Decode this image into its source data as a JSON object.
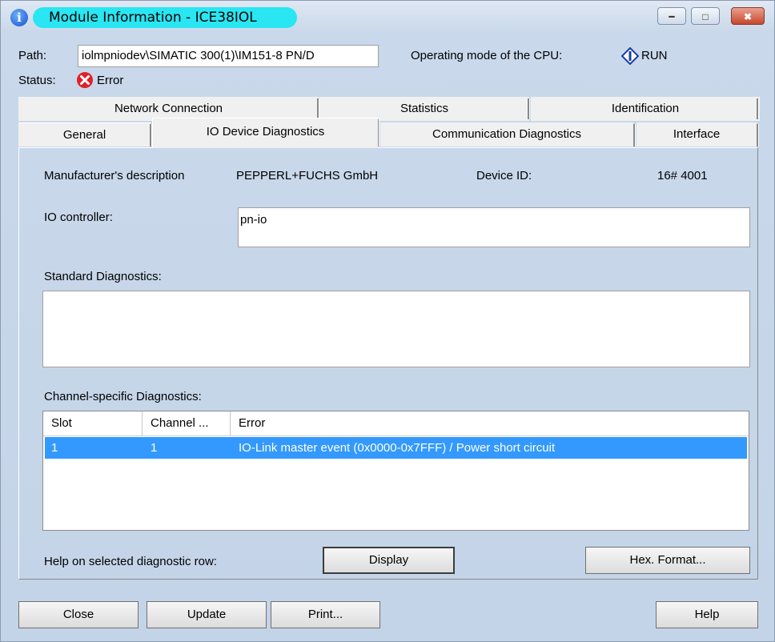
{
  "window": {
    "title": "Module Information - ICE38IOL",
    "app_icon": "info-icon",
    "controls": [
      "minimize-icon",
      "maximize-icon",
      "close-icon"
    ]
  },
  "header": {
    "path_label": "Path:",
    "path_value": "iolmpniodev\\SIMATIC 300(1)\\IM151-8 PN/D",
    "operating_mode_label": "Operating mode of the  CPU:",
    "operating_mode_value": "RUN",
    "operating_mode_icon": "run-diamond-icon",
    "status_label": "Status:",
    "status_value": "Error",
    "status_icon": "error-x-icon"
  },
  "tabs": {
    "row1": [
      "Network Connection",
      "Statistics",
      "Identification"
    ],
    "row2": [
      "General",
      "IO Device Diagnostics",
      "Communication Diagnostics",
      "Interface"
    ],
    "active": "IO Device Diagnostics"
  },
  "device": {
    "manufacturer_label": "Manufacturer's description",
    "manufacturer_value": "PEPPERL+FUCHS GmbH",
    "device_id_label": "Device ID:",
    "device_id_value": "16# 4001",
    "io_controller_label": "IO controller:",
    "io_controller_value": "pn-io",
    "standard_diag_label": "Standard Diagnostics:",
    "standard_diag_value": ""
  },
  "channel_diag": {
    "label": "Channel-specific Diagnostics:",
    "columns": [
      "Slot",
      "Channel ...",
      "Error"
    ],
    "rows": [
      {
        "slot": "1",
        "channel": "1",
        "error": "IO-Link master event (0x0000-0x7FFF) / Power short circuit",
        "selected": true
      }
    ]
  },
  "help": {
    "label": "Help on selected diagnostic row:",
    "display_button": "Display",
    "hex_button": "Hex. Format..."
  },
  "footer": {
    "close": "Close",
    "update": "Update",
    "print": "Print...",
    "help": "Help"
  },
  "colors": {
    "title_highlight": "#29e6f2",
    "selection": "#3399ff",
    "error_icon": "#e0202a",
    "run_icon": "#1a3fa8"
  }
}
